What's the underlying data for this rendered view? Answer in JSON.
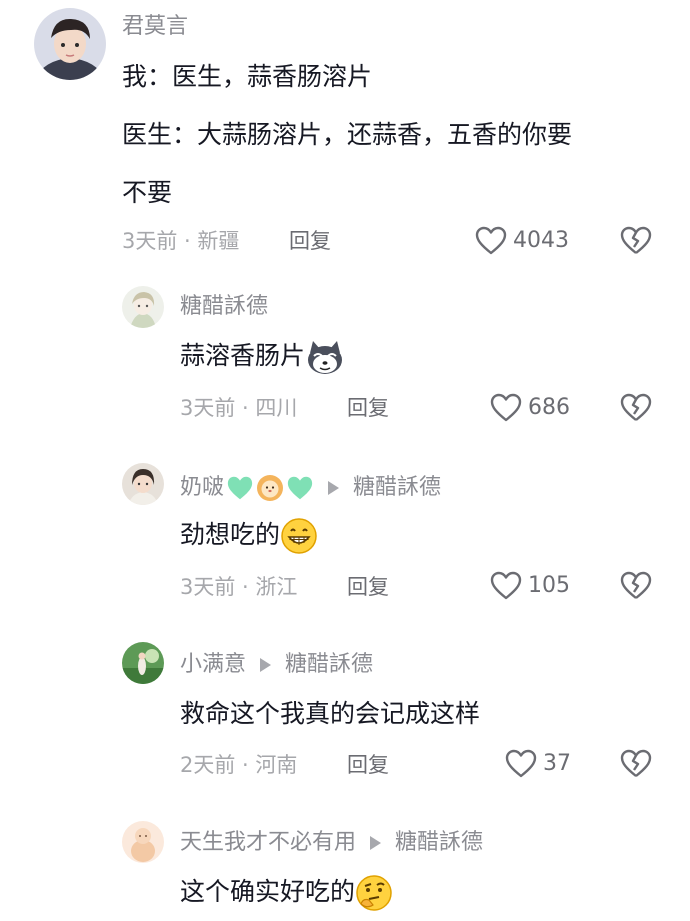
{
  "comments": [
    {
      "user": "君莫言",
      "lines": [
        "我：医生，蒜香肠溶片",
        "医生：大蒜肠溶片，还蒜香，五香的你要",
        "不要"
      ],
      "time_location": "3天前 · 新疆",
      "reply_label": "回复",
      "likes": "4043",
      "avatar_icon": "avatar-young-man"
    },
    {
      "user": "糖醋訸德",
      "lines": [
        "蒜溶香肠片"
      ],
      "emoji_icon": "husky-dog-emoji",
      "time_location": "3天前 · 四川",
      "reply_label": "回复",
      "likes": "686",
      "avatar_icon": "avatar-anime-girl"
    },
    {
      "user": "奶啵",
      "badge_icons": [
        "green-heart-icon",
        "lion-face-icon",
        "green-heart-icon"
      ],
      "reply_to": "糖醋訸德",
      "lines": [
        "劲想吃的"
      ],
      "emoji_icon": "grinning-face-emoji",
      "time_location": "3天前 · 浙江",
      "reply_label": "回复",
      "likes": "105",
      "avatar_icon": "avatar-girl-portrait"
    },
    {
      "user": "小满意",
      "reply_to": "糖醋訸德",
      "lines": [
        "救命这个我真的会记成这样"
      ],
      "time_location": "2天前 · 河南",
      "reply_label": "回复",
      "likes": "37",
      "avatar_icon": "avatar-outdoor-green"
    },
    {
      "user": "天生我才不必有用",
      "reply_to": "糖醋訸德",
      "lines": [
        "这个确实好吃的"
      ],
      "emoji_icon": "thinking-face-emoji",
      "avatar_icon": "avatar-peach-figure"
    }
  ],
  "colors": {
    "username": "#8a8b91",
    "text": "#161823",
    "meta": "#a6a7ab",
    "icon": "#6b6c72"
  }
}
